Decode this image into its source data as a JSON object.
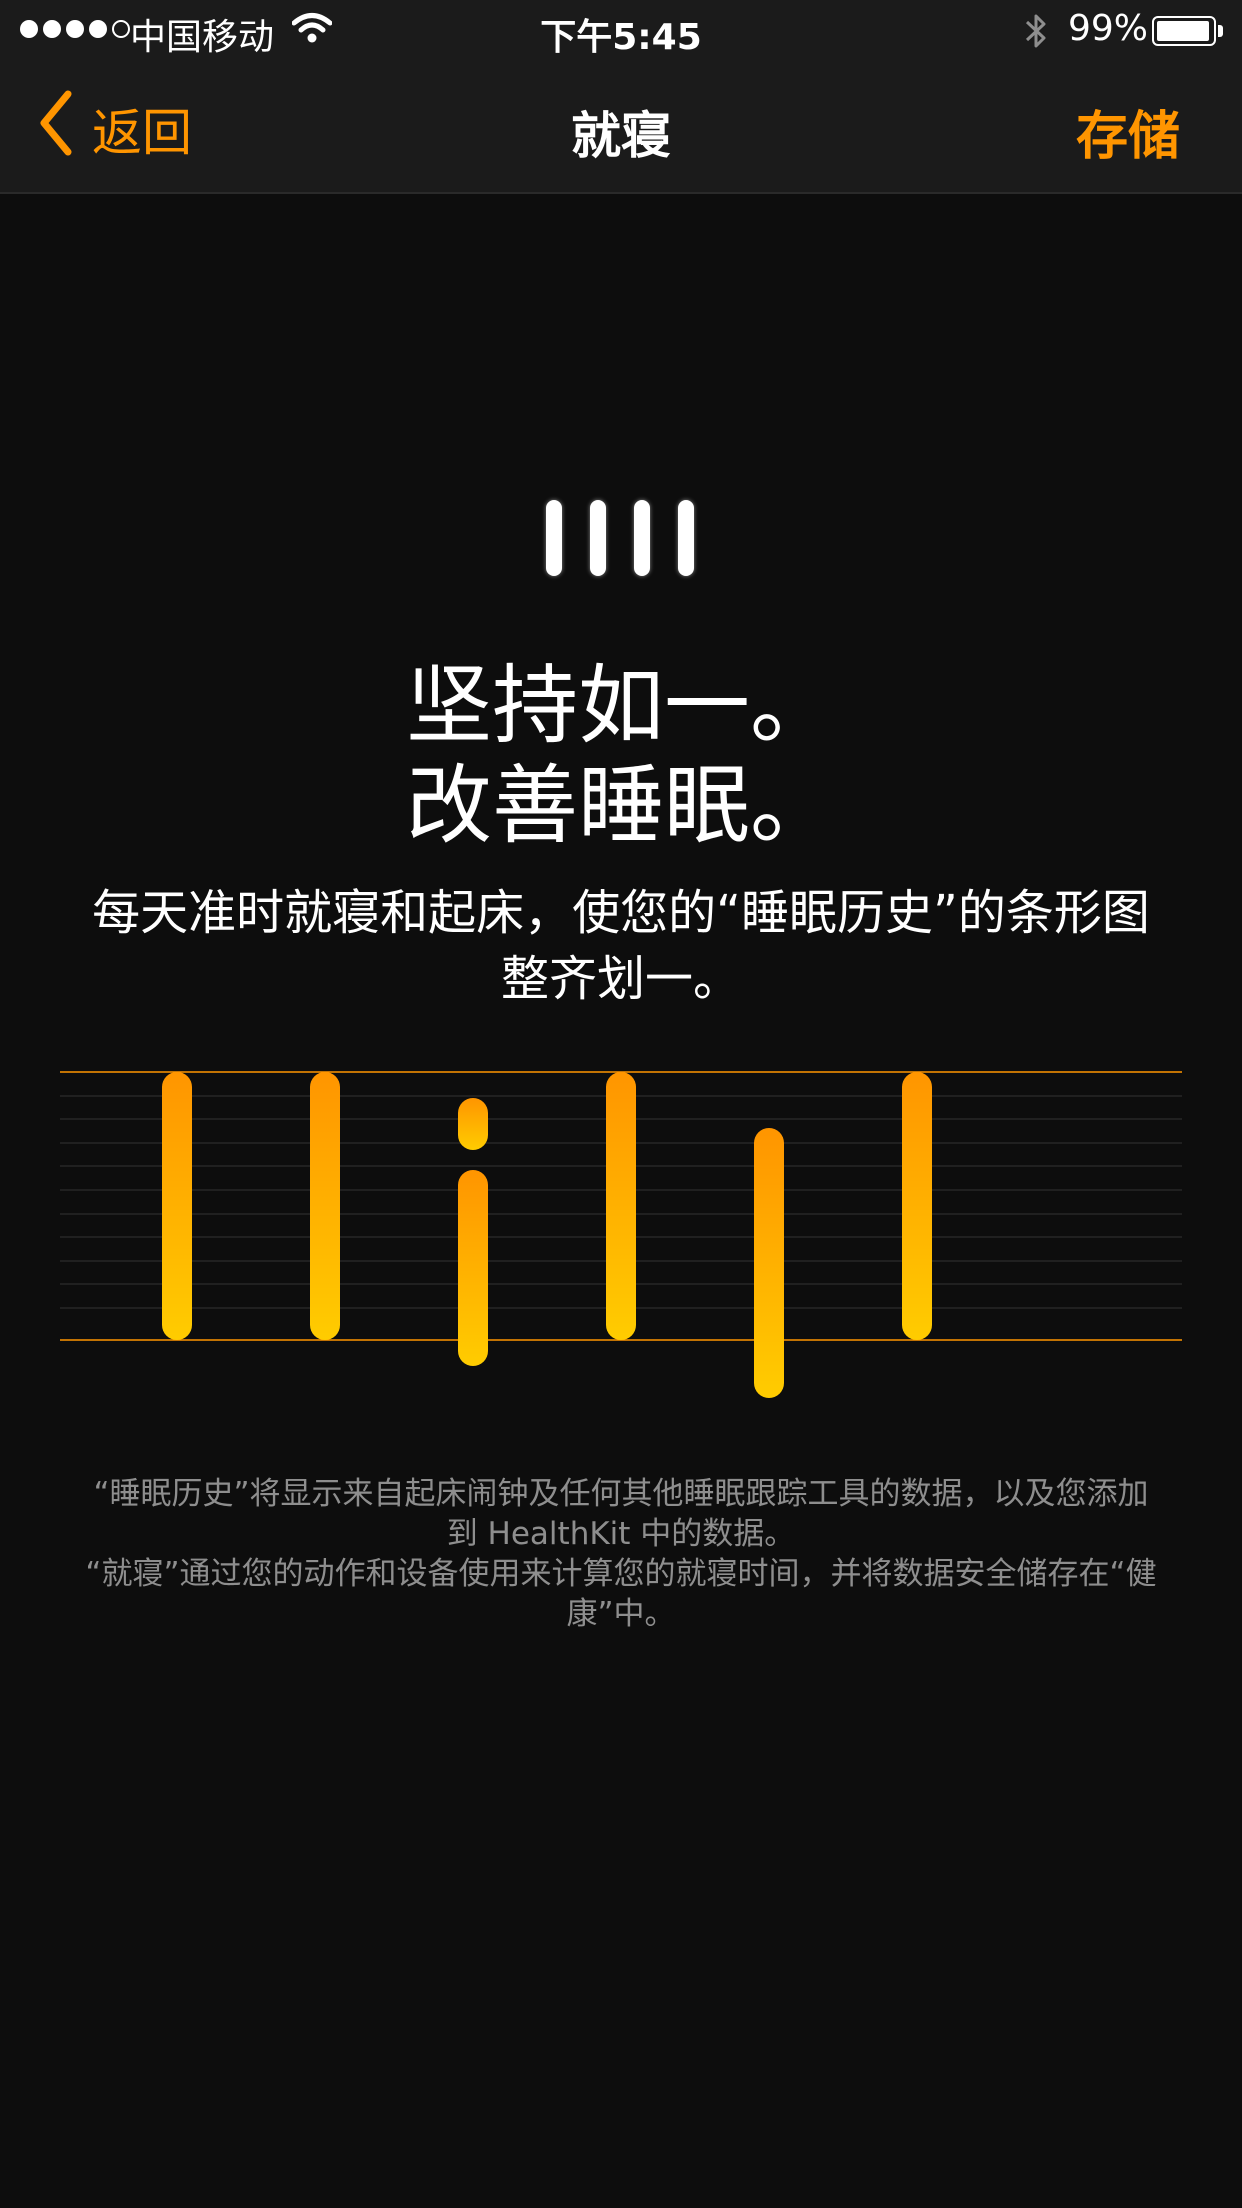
{
  "status_bar": {
    "carrier": "中国移动",
    "time": "下午5:45",
    "battery": "99%",
    "signal_strength": 4,
    "signal_max": 5
  },
  "nav": {
    "back_label": "返回",
    "title": "就寝",
    "save_label": "存储"
  },
  "main": {
    "headline_line1": "坚持如一。",
    "headline_line2": "改善睡眠。",
    "subtitle": "每天准时就寝和起床，使您的“睡眠历史”的条形图整齐划一。",
    "footnote_1": "“睡眠历史”将显示来自起床闹钟及任何其他睡眠跟踪工具的数据，以及您添加到 HealthKit 中的数据。",
    "footnote_2": "“就寝”通过您的动作和设备使用来计算您的就寝时间，并将数据安全储存在“健康”中。"
  },
  "colors": {
    "accent": "#ff9500",
    "bar_top": "#ff9500",
    "bar_bottom": "#ffcc00",
    "background": "#0d0d0d",
    "footnote": "#8e8e8e"
  },
  "icons": [
    "wifi-icon",
    "bluetooth-icon",
    "battery-icon",
    "chevron-left-icon",
    "bedtime-logo-icon"
  ]
}
